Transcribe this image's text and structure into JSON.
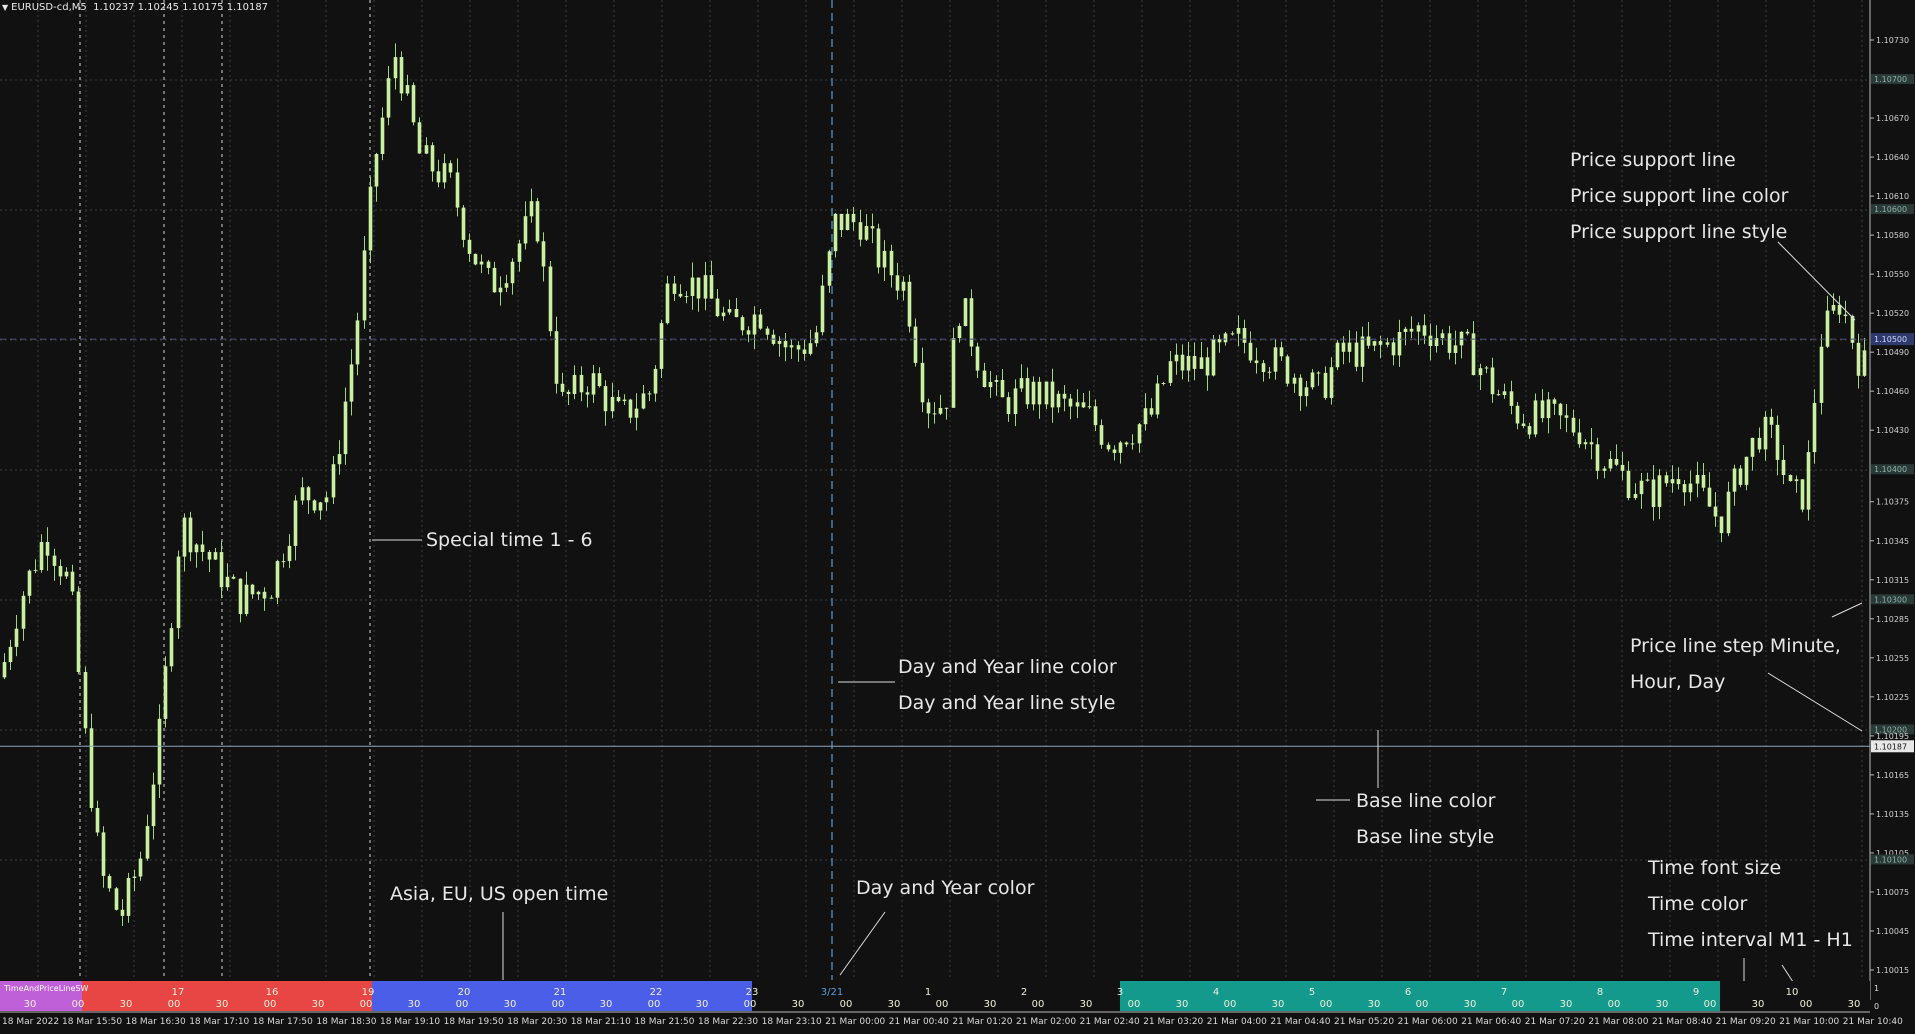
{
  "window": {
    "symbol": "EURUSD-cd,M5",
    "ohlc": "1.10237 1.10245 1.10175 1.10187"
  },
  "price_axis": {
    "labels": [
      "1.10730",
      "1.10700",
      "1.10670",
      "1.10640",
      "1.10610",
      "1.10600",
      "1.10580",
      "1.10550",
      "1.10520",
      "1.10500",
      "1.10490",
      "1.10460",
      "1.10430",
      "1.10400",
      "1.10375",
      "1.10345",
      "1.10315",
      "1.10300",
      "1.10285",
      "1.10255",
      "1.10225",
      "1.10200",
      "1.10195",
      "1.10187",
      "1.10165",
      "1.10135",
      "1.10105",
      "1.10100",
      "1.10075",
      "1.10045",
      "1.10015"
    ],
    "current_price": "1.10187",
    "bid_marker": "1.10500"
  },
  "time_axis": {
    "labels": [
      "18 Mar 2022",
      "18 Mar 15:50",
      "18 Mar 16:30",
      "18 Mar 17:10",
      "18 Mar 17:50",
      "18 Mar 18:30",
      "18 Mar 19:10",
      "18 Mar 19:50",
      "18 Mar 20:30",
      "18 Mar 21:10",
      "18 Mar 21:50",
      "18 Mar 22:30",
      "18 Mar 23:10",
      "21 Mar 00:00",
      "21 Mar 00:40",
      "21 Mar 01:20",
      "21 Mar 02:00",
      "21 Mar 02:40",
      "21 Mar 03:20",
      "21 Mar 04:00",
      "21 Mar 04:40",
      "21 Mar 05:20",
      "21 Mar 06:00",
      "21 Mar 06:40",
      "21 Mar 07:20",
      "21 Mar 08:00",
      "21 Mar 08:40",
      "21 Mar 09:20",
      "21 Mar 10:00",
      "21 Mar 10:40"
    ]
  },
  "indicator_bar": {
    "name": "TimeAndPriceLineSW",
    "hours": [
      "16",
      "17",
      "16",
      "19",
      "20",
      "21",
      "22",
      "23",
      "3/21",
      "1",
      "2",
      "3",
      "4",
      "5",
      "6",
      "7",
      "8",
      "9",
      "10"
    ],
    "half_label": "30",
    "zero_label": "00",
    "colors": {
      "asia": "#c060d8",
      "eu": "#e84545",
      "us": "#4a5ee8",
      "session": "#139a8c",
      "day": "#5a9bd5"
    }
  },
  "annotations": {
    "price_support": [
      "Price support line",
      "Price support line color",
      "Price support line style"
    ],
    "special_time": "Special time 1 - 6",
    "day_year_line": [
      "Day and Year line color",
      "Day and Year line style"
    ],
    "price_step": [
      "Price line step Minute,",
      "Hour, Day"
    ],
    "base_line": [
      "Base line color",
      "Base line style"
    ],
    "open_time": "Asia, EU, US open time",
    "day_year_color": "Day and Year color",
    "time_settings": [
      "Time font size",
      "Time color",
      "Time interval M1 - H1"
    ]
  },
  "colors": {
    "background": "#111111",
    "candle": "#c8f0a0",
    "wick": "#9fd67d",
    "grid": "#3a3a3a",
    "text": "#e6e6e6"
  }
}
